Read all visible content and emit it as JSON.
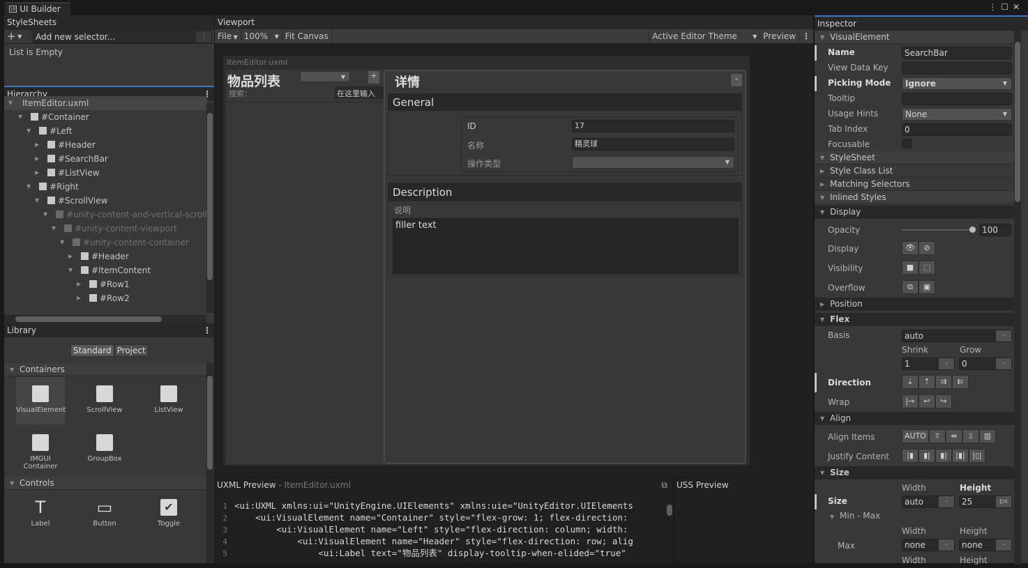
{
  "window": {
    "tab": "UI Builder"
  },
  "stylesheets": {
    "title": "StyleSheets",
    "add_placeholder": "Add new selector...",
    "empty": "List is Empty"
  },
  "hierarchy": {
    "title": "Hierarchy",
    "items": [
      {
        "label": "ItemEditor.uxml",
        "depth": 0,
        "root": true
      },
      {
        "label": "#Container",
        "depth": 1
      },
      {
        "label": "#Left",
        "depth": 2
      },
      {
        "label": "#Header",
        "depth": 3,
        "collapsed": true
      },
      {
        "label": "#SearchBar",
        "depth": 3,
        "collapsed": true
      },
      {
        "label": "#ListView",
        "depth": 3,
        "collapsed": true
      },
      {
        "label": "#Right",
        "depth": 2
      },
      {
        "label": "#ScrollView",
        "depth": 3
      },
      {
        "label": "#unity-content-and-vertical-scroll-",
        "depth": 4,
        "dim": true
      },
      {
        "label": "#unity-content-viewport",
        "depth": 5,
        "dim": true
      },
      {
        "label": "#unity-content-container",
        "depth": 6,
        "dim": true
      },
      {
        "label": "#Header",
        "depth": 7,
        "collapsed": true
      },
      {
        "label": "#ItemContent",
        "depth": 7
      },
      {
        "label": "#Row1",
        "depth": 8,
        "collapsed": true
      },
      {
        "label": "#Row2",
        "depth": 8,
        "collapsed": true
      }
    ]
  },
  "library": {
    "title": "Library",
    "tabs": [
      "Standard",
      "Project"
    ],
    "containers_title": "Containers",
    "containers": [
      "VisualElement",
      "ScrollView",
      "ListView",
      "IMGUI Container",
      "GroupBox"
    ],
    "controls_title": "Controls",
    "controls": [
      "Label",
      "Button",
      "Toggle"
    ]
  },
  "viewport": {
    "title": "Viewport",
    "file": "File",
    "zoom": "100%",
    "fit": "Fit Canvas",
    "theme": "Active Editor Theme",
    "preview": "Preview",
    "doc": {
      "title": "ItemEditor.uxml",
      "list_title": "物品列表",
      "add": "+",
      "search_label": "搜索：",
      "search_placeholder": "在这里输入",
      "details_title": "详情",
      "remove": "-",
      "general": "General",
      "fields": [
        {
          "label": "ID",
          "value": "17"
        },
        {
          "label": "名称",
          "value": "精灵球"
        },
        {
          "label": "操作类型",
          "value": ""
        }
      ],
      "description": "Description",
      "desc_label": "说明",
      "desc_value": "filler text"
    }
  },
  "uxml_preview": {
    "title": "UXML Preview",
    "file": "- ItemEditor.uxml",
    "lines": [
      "<ui:UXML xmlns:ui=\"UnityEngine.UIElements\" xmlns:uie=\"UnityEditor.UIElements",
      "    <ui:VisualElement name=\"Container\" style=\"flex-grow: 1; flex-direction:",
      "        <ui:VisualElement name=\"Left\" style=\"flex-direction: column; width:",
      "            <ui:VisualElement name=\"Header\" style=\"flex-direction: row; alig",
      "                <ui:Label text=\"物品列表\" display-tooltip-when-elided=\"true\" "
    ]
  },
  "uss_preview": {
    "title": "USS Preview"
  },
  "inspector": {
    "title": "Inspector",
    "visual_element": "VisualElement",
    "name_label": "Name",
    "name_value": "SearchBar",
    "view_data_key": "View Data Key",
    "picking_mode": "Picking Mode",
    "picking_value": "Ignore",
    "tooltip": "Tooltip",
    "usage_hints": "Usage Hints",
    "usage_value": "None",
    "tab_index": "Tab Index",
    "tab_value": "0",
    "focusable": "Focusable",
    "stylesheet": "StyleSheet",
    "style_class_list": "Style Class List",
    "matching_selectors": "Matching Selectors",
    "inlined": "Inlined Styles",
    "display_section": "Display",
    "opacity": "Opacity",
    "opacity_value": "100",
    "display": "Display",
    "visibility": "Visibility",
    "overflow": "Overflow",
    "position": "Position",
    "flex": "Flex",
    "basis": "Basis",
    "basis_value": "auto",
    "shrink": "Shrink",
    "shrink_value": "1",
    "grow": "Grow",
    "grow_value": "0",
    "direction": "Direction",
    "wrap": "Wrap",
    "align": "Align",
    "align_items": "Align Items",
    "align_auto": "AUTO",
    "justify": "Justify Content",
    "size_section": "Size",
    "width": "Width",
    "height": "Height",
    "size": "Size",
    "size_w": "auto",
    "size_h": "25",
    "unit_px": "px",
    "unit_dash": "-",
    "minmax": "Min - Max",
    "max": "Max",
    "max_w": "none",
    "max_h": "none"
  }
}
